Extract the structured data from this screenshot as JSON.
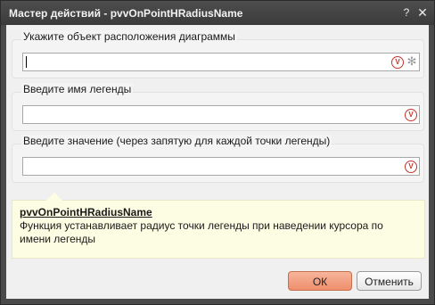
{
  "window": {
    "title": "Мастер действий - pvvOnPointHRadiusName",
    "help_glyph": "?",
    "close_glyph": "✕"
  },
  "fields": [
    {
      "label": "Укажите объект расположения диаграммы",
      "value": "",
      "has_focus": true,
      "icons": [
        "validate-icon",
        "gear-icon"
      ]
    },
    {
      "label": "Введите имя легенды",
      "value": "",
      "icons": [
        "validate-icon"
      ]
    },
    {
      "label": "Введите значение (через запятую для каждой точки легенды)",
      "value": "",
      "icons": [
        "validate-icon"
      ]
    }
  ],
  "icon_glyphs": {
    "validate": "V",
    "gear": "✻"
  },
  "help": {
    "title": "pvvOnPointHRadiusName",
    "description": "Функция устанавливает радиус точки легенды при наведении курсора по имени легенды"
  },
  "buttons": {
    "ok": "ОК",
    "cancel": "Отменить"
  },
  "colors": {
    "titlebar": "#4a4a4a",
    "help_background": "#fdfde3",
    "ok_button": "#f09a7a",
    "validate_icon": "#c4342d"
  }
}
